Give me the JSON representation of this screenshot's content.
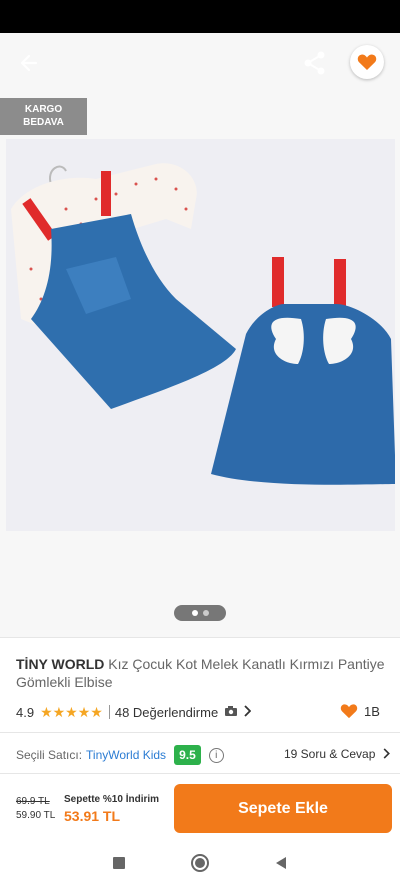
{
  "header": {
    "back_icon": "arrow-left-icon",
    "share_icon": "share-icon",
    "favorite_icon": "heart-icon"
  },
  "gallery": {
    "badge_line1": "KARGO",
    "badge_line2": "BEDAVA",
    "page_count": 2,
    "active_page": 1
  },
  "product": {
    "brand": "TİNY WORLD",
    "name": "Kız Çocuk Kot Melek Kanatlı Kırmızı Pantiye Gömlekli Elbise",
    "rating": "4.9",
    "stars": "★★★★★",
    "reviews": "48 Değerlendirme",
    "likes": "1B"
  },
  "seller": {
    "label": "Seçili Satıcı:",
    "name": "TinyWorld Kids",
    "score": "9.5",
    "qa": "19 Soru & Cevap"
  },
  "pricing": {
    "old_price": "69.9 TL",
    "base_price": "59.90 TL",
    "campaign": "Sepette %10 İndirim",
    "final_price": "53.91 TL",
    "add_to_cart": "Sepete Ekle"
  },
  "colors": {
    "accent": "#f27a1a",
    "seller_score_bg": "#2db14b",
    "link": "#2b7cd3",
    "star": "#f5a623"
  }
}
